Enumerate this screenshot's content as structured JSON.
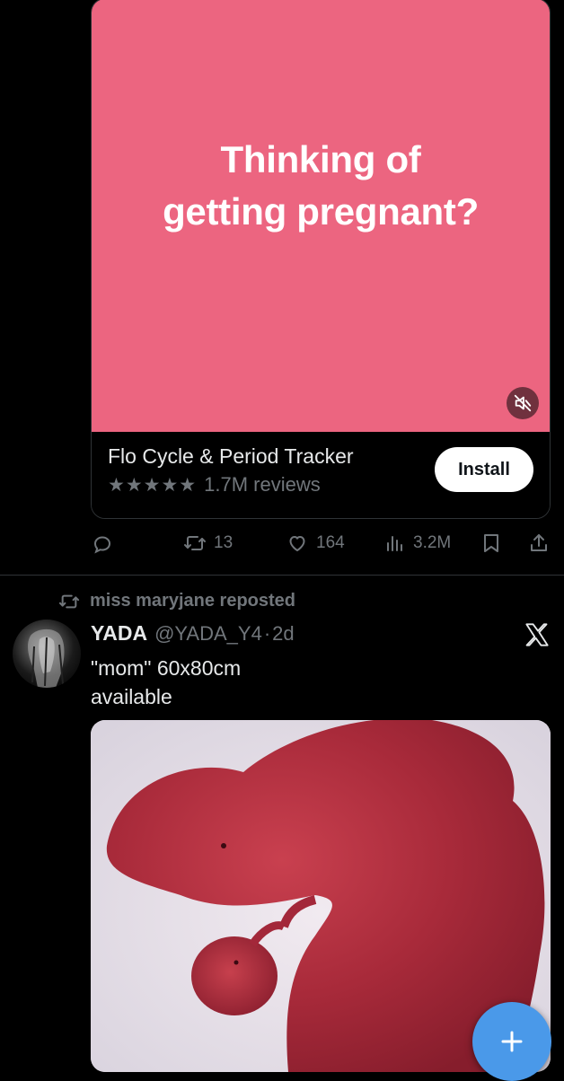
{
  "ad": {
    "headline": "Thinking of getting pregnant?",
    "app_name": "Flo Cycle & Period Tracker",
    "stars": "★★★★★",
    "reviews": "1.7M reviews",
    "install_label": "Install",
    "media_color": "#ec6580"
  },
  "ad_actions": {
    "reposts": "13",
    "likes": "164",
    "views": "3.2M"
  },
  "repost_banner": "miss maryjane reposted",
  "tweet": {
    "display_name": "YADA",
    "handle": "@YADA_Y4",
    "separator": "·",
    "time": "2d",
    "text": "\"mom\" 60x80cm\navailable"
  },
  "colors": {
    "background": "#000000",
    "muted": "#71767b",
    "fab": "#4a99e9"
  },
  "icons": [
    "mute-icon",
    "reply-icon",
    "repost-icon",
    "like-icon",
    "views-icon",
    "bookmark-icon",
    "share-icon",
    "x-logo-icon",
    "plus-icon"
  ]
}
